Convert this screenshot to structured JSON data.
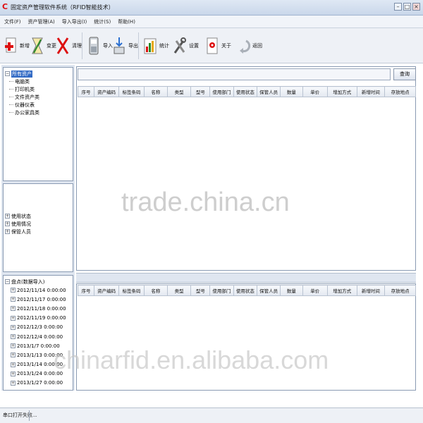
{
  "window": {
    "title": "固定资产管理软件系统（RFID智能技术）",
    "controls": [
      "–",
      "□",
      "×"
    ]
  },
  "menu": [
    "文件(F)",
    "资产管理(A)",
    "导入导出(I)",
    "统计(S)",
    "帮助(H)"
  ],
  "toolbar": [
    {
      "label": "新增",
      "icon": "add-icon"
    },
    {
      "label": "变更",
      "icon": "edit-icon"
    },
    {
      "label": "清理",
      "icon": "delete-icon"
    },
    {
      "label": "导入",
      "icon": "import-icon"
    },
    {
      "label": "导出",
      "icon": "export-icon"
    },
    {
      "label": "统计",
      "icon": "chart-icon"
    },
    {
      "label": "设置",
      "icon": "settings-icon"
    },
    {
      "label": "关于",
      "icon": "about-icon"
    },
    {
      "label": "返回",
      "icon": "back-icon"
    }
  ],
  "tree_assets": {
    "root": "所有资产",
    "children": [
      "电脑类",
      "打印机类",
      "文件资产类",
      "仪器仪表",
      "办公家具类"
    ]
  },
  "tree_filters": [
    "使用状态",
    "使用情况",
    "保管人员"
  ],
  "tree_inventory": {
    "root": "盘点(数据导入)",
    "dates": [
      "2012/11/14 0:00:00",
      "2012/11/17 0:00:00",
      "2012/11/18 0:00:00",
      "2012/11/19 0:00:00",
      "2012/12/3 0:00:00",
      "2012/12/4 0:00:00",
      "2013/1/7 0:00:00",
      "2013/1/13 0:00:00",
      "2013/1/14 0:00:00",
      "2013/1/24 0:00:00",
      "2013/1/27 0:00:00"
    ]
  },
  "search": {
    "button": "查询",
    "value": ""
  },
  "table_headers": [
    "序号",
    "资产编码",
    "标签条码",
    "名称",
    "类型",
    "型号",
    "使用部门",
    "使用状态",
    "保管人员",
    "数量",
    "单价",
    "增加方式",
    "新增时间",
    "存放地点"
  ],
  "status": {
    "text": "串口打开失败..."
  },
  "watermarks": [
    "trade.china.cn",
    "chinarfid.en.alibaba.com"
  ],
  "colors": {
    "selection": "#316ac5",
    "logo": "#e01010"
  }
}
